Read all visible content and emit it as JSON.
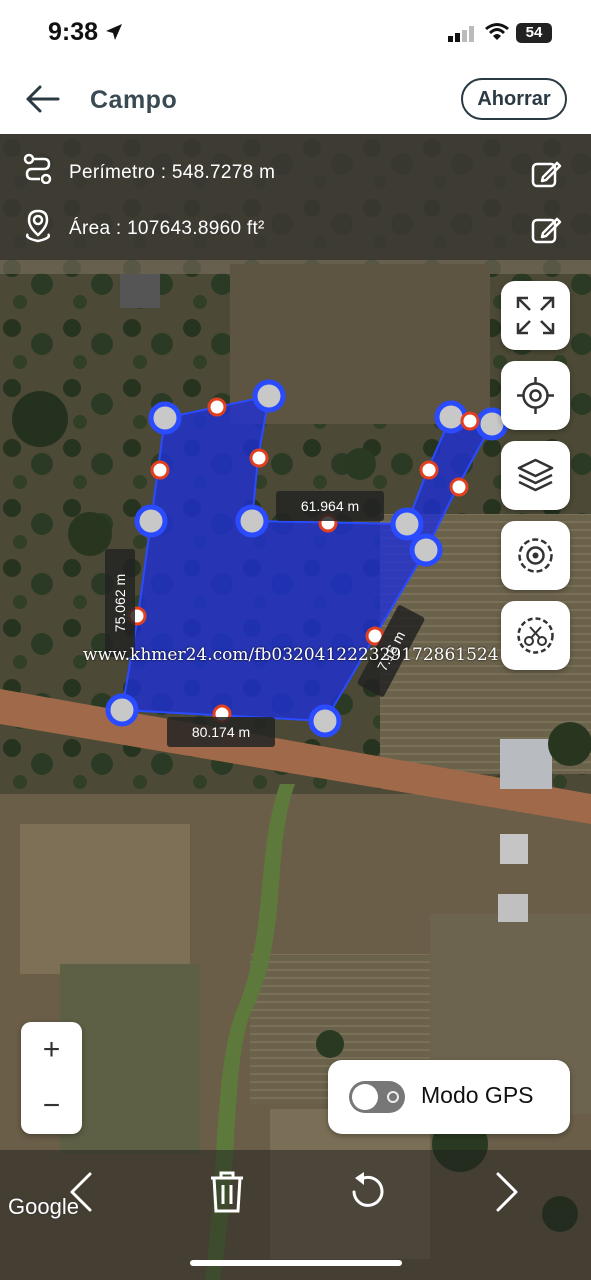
{
  "status_bar": {
    "time": "9:38",
    "battery": "54"
  },
  "header": {
    "title": "Campo",
    "save_label": "Ahorrar"
  },
  "info": {
    "perimeter": "Perímetro : 548.7278 m",
    "area": "Área : 107643.8960 ft²"
  },
  "segments": {
    "top_right": "61.964 m",
    "left": "75.062 m",
    "bottom": "80.174 m",
    "right": "7.16 m"
  },
  "watermark": "www.khmer24.com/fb032041222329172861524",
  "gps": {
    "label": "Modo GPS",
    "enabled": false
  },
  "zoom": {
    "in": "+",
    "out": "−"
  },
  "google": "Google",
  "colors": {
    "polygon": "#1e2fd8",
    "vertex": "#2a4bff",
    "midpoint": "#e04020"
  },
  "icons": [
    "back-arrow-icon",
    "route-icon",
    "location-pin-icon",
    "edit-icon",
    "expand-icon",
    "target-icon",
    "layers-icon",
    "location-center-icon",
    "scissors-icon",
    "chevron-left-icon",
    "trash-icon",
    "undo-icon",
    "chevron-right-icon"
  ]
}
